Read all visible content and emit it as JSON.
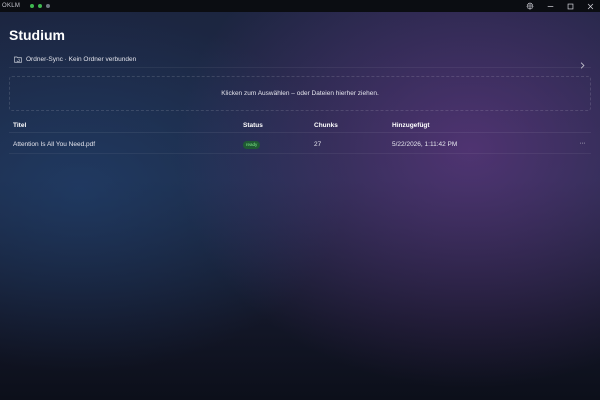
{
  "app": {
    "name": "OKLM"
  },
  "page": {
    "title": "Studium"
  },
  "sync": {
    "text": "Ordner-Sync · Kein Ordner verbunden"
  },
  "dropzone": {
    "text": "Klicken zum Auswählen – oder Dateien hierher ziehen."
  },
  "table": {
    "headers": {
      "title": "Titel",
      "status": "Status",
      "chunks": "Chunks",
      "added": "Hinzugefügt"
    },
    "rows": [
      {
        "title": "Attention Is All You Need.pdf",
        "status": "ready",
        "chunks": "27",
        "added": "5/22/2026, 1:11:42 PM",
        "more": "···"
      }
    ]
  },
  "colors": {
    "status_ready_bg": "#1f5a33",
    "status_ready_text": "#7ee787",
    "window_dot_active": "#3fb950"
  },
  "icons": [
    "settings-icon",
    "minimize-icon",
    "maximize-icon",
    "close-icon",
    "folder-sync-icon",
    "chevron-right-icon",
    "more-icon"
  ]
}
